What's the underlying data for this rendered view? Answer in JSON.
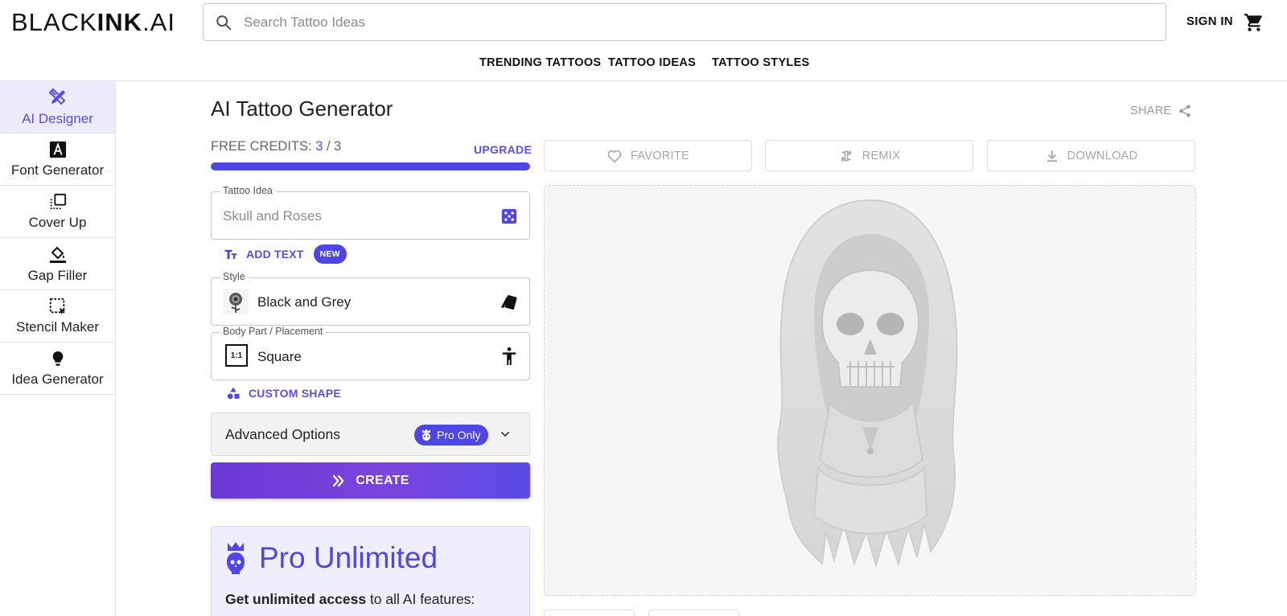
{
  "header": {
    "logo_part1": "BLACK",
    "logo_part2": "INK",
    "logo_part3": ".AI",
    "search_placeholder": "Search Tattoo Ideas",
    "sign_in": "SIGN IN",
    "nav": [
      "TRENDING TATTOOS",
      "TATTOO IDEAS",
      "TATTOO STYLES"
    ]
  },
  "sidebar": {
    "items": [
      {
        "label": "AI Designer",
        "icon": "pencil-ruler-icon",
        "active": true
      },
      {
        "label": "Font Generator",
        "icon": "font-a-icon"
      },
      {
        "label": "Cover Up",
        "icon": "cover-up-icon"
      },
      {
        "label": "Gap Filler",
        "icon": "paint-bucket-icon"
      },
      {
        "label": "Stencil Maker",
        "icon": "stencil-select-icon"
      },
      {
        "label": "Idea Generator",
        "icon": "lightbulb-icon"
      }
    ]
  },
  "main": {
    "title": "AI Tattoo Generator",
    "share": "SHARE",
    "credits_label": "FREE CREDITS: ",
    "credits_used": "3",
    "credits_sep": " / ",
    "credits_total": "3",
    "credits_fill": 1.0,
    "upgrade": "UPGRADE",
    "tattoo_idea_legend": "Tattoo Idea",
    "tattoo_idea_placeholder": "Skull and Roses",
    "add_text": "ADD TEXT",
    "new_badge": "NEW",
    "style_legend": "Style",
    "style_value": "Black and Grey",
    "placement_legend": "Body Part / Placement",
    "placement_value": "Square",
    "placement_thumb": "1:1",
    "custom_shape": "CUSTOM SHAPE",
    "advanced_options": "Advanced Options",
    "pro_only": "Pro Only",
    "create": "CREATE",
    "pro_title": "Pro Unlimited",
    "pro_desc_bold": "Get unlimited access",
    "pro_desc_rest": " to all AI features:"
  },
  "actions": {
    "favorite": "FAVORITE",
    "remix": "REMIX",
    "download": "DOWNLOAD"
  },
  "colors": {
    "accent": "#4f46e5",
    "accent_light": "#ecebfc",
    "create_gradient_start": "#6a39d6"
  }
}
